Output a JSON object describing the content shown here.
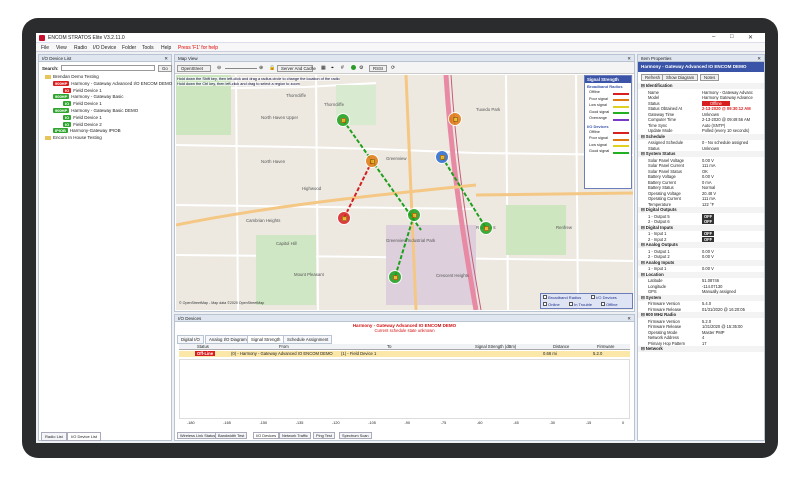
{
  "window": {
    "title": "ENCOM STRATOS Elite V3.2.11.0"
  },
  "menu": [
    "File",
    "View",
    "Radio",
    "I/O Device",
    "Folder",
    "Tools",
    "Help"
  ],
  "menu_hint": "Press 'F1' for help",
  "io_list": {
    "title": "I/O Device List",
    "search_label": "Search:",
    "search_value": "",
    "search_btn": "Go",
    "rows": [
      {
        "kind": "folder",
        "label": "Brendan Demo Testing"
      },
      {
        "kind": "radio",
        "badge": "900HP",
        "badge_color": "red",
        "label": "Harmony - Gateway Advanced I/O ENCOM DEMO"
      },
      {
        "kind": "io",
        "badge": "IO",
        "badge_color": "red",
        "label": "Field Device 1"
      },
      {
        "kind": "radio",
        "badge": "900HP",
        "badge_color": "green",
        "label": "Harmony - Gateway Basic"
      },
      {
        "kind": "io",
        "badge": "IO",
        "badge_color": "green",
        "label": "Field Device 1"
      },
      {
        "kind": "radio",
        "badge": "900HP",
        "badge_color": "green",
        "label": "Harmony - Gateway Basic DEMO"
      },
      {
        "kind": "io",
        "badge": "IO",
        "badge_color": "green",
        "label": "Field Device 1"
      },
      {
        "kind": "io",
        "badge": "IO",
        "badge_color": "green",
        "label": "Field Device 2"
      },
      {
        "kind": "radio",
        "badge": "IPIOB",
        "badge_color": "green",
        "label": "Harmony-Gateway IPIOB"
      },
      {
        "kind": "folder",
        "label": "Encom In House Testing"
      }
    ],
    "bottom_tabs": [
      "Radio List",
      "I/O Device List"
    ]
  },
  "map": {
    "title": "Map View",
    "provider": "OpenStreet",
    "layer": "Server And Cache",
    "rssi": "RSSI",
    "hint1": "Hold down the Shift key, then left-click and drag a radius circle to change the location of the radio",
    "hint2": "Hold down the Ctrl key, then left-click and drag to select a region to zoom",
    "place_labels": [
      "Thorncliffe",
      "North Haven Upper",
      "North Haven",
      "Highwood",
      "Greenview",
      "Cambrian Heights",
      "Greenview Industrial Park",
      "Thorncliffe",
      "Rosemont",
      "Capitol Hill",
      "Mount Pleasant",
      "Tuxedo Park",
      "Renfrew",
      "Crescent Heights"
    ],
    "attribution": "© OpenStreetMap - Map data ©2020 OpenStreetMap",
    "legend": {
      "title": "Signal Strength",
      "broadband_title": "Broadband Radios",
      "broadband": [
        [
          "Offline",
          "#d82020"
        ],
        [
          "Poor signal",
          "#e07a10"
        ],
        [
          "Low signal",
          "#e0d020"
        ],
        [
          "Good signal",
          "#22b022"
        ],
        [
          "Overrange",
          "#7a3ac8"
        ]
      ],
      "io_title": "I/O Devices",
      "io": [
        [
          "Offline",
          "#d82020"
        ],
        [
          "Poor signal",
          "#e07a10"
        ],
        [
          "Low signal",
          "#e0d020"
        ],
        [
          "Good signal",
          "#22b022"
        ]
      ]
    },
    "filters": [
      "Broadband Radios",
      "I/O Devices",
      "Online",
      "In Trouble",
      "Offline"
    ]
  },
  "io_devices": {
    "title": "I/O Devices",
    "heading": "Harmony - Gateway Advanced IO ENCOM DEMO",
    "subheading": "Current schedule state unknown",
    "tabs": [
      "Digital I/O",
      "Analog I/O Diagram",
      "Signal Strength",
      "Schedule Assignment"
    ],
    "columns": [
      "Status",
      "From",
      "To",
      "Signal Strength (dBm)",
      "Distance",
      "Firmware"
    ],
    "row": {
      "status": "Off-Line",
      "from": "(0) - Harmony - Gateway Advanced IO ENCOM DEMO",
      "to": "(1) - Field Device 1",
      "signal": "",
      "distance": "0.66 mi",
      "firmware": "5.2.0"
    },
    "scale": [
      "-180",
      "-165",
      "-150",
      "-135",
      "-120",
      "-105",
      "-90",
      "-75",
      "-60",
      "-45",
      "-30",
      "-15",
      "0"
    ],
    "bottom_tabs": [
      "Wireless Link Status",
      "Bandwidth Test",
      "I/O Devices",
      "Network Traffic",
      "Ping Test",
      "Spectrum Scan"
    ]
  },
  "props": {
    "title": "Item Properties",
    "header": "Harmony - Gateway Advanced IO ENCOM DEMO",
    "buttons": [
      "Refresh",
      "Show Diagram",
      "Notes"
    ],
    "sections": [
      {
        "name": "Identification",
        "rows": [
          [
            "Name",
            "Harmony - Gateway Advanc"
          ],
          [
            "Model",
            "Harmony Gateway Advance"
          ],
          [
            "Status",
            "Offline"
          ],
          [
            "Status Obtained At",
            "2-13-2020 @ 09:30:12 AM"
          ],
          [
            "Gateway Time",
            "Unknown"
          ],
          [
            "Computer Time",
            "2-13-2020 @ 09:49:56 AM"
          ],
          [
            "Time Sync",
            "Auto (SNTP)"
          ],
          [
            "Update Mode",
            "Polled (every 10 seconds)"
          ]
        ]
      },
      {
        "name": "Schedule",
        "rows": [
          [
            "Assigned Schedule",
            "0 - No schedule assigned"
          ],
          [
            "Status",
            "Unknown"
          ]
        ]
      },
      {
        "name": "System Status",
        "rows": [
          [
            "Solar Panel Voltage",
            "0.00 V"
          ],
          [
            "Solar Panel Current",
            "111 mA"
          ],
          [
            "Solar Panel Status",
            "OK"
          ],
          [
            "Battery Voltage",
            "0.00 V"
          ],
          [
            "Battery Current",
            "0 mA"
          ],
          [
            "Battery Status",
            "Normal"
          ],
          [
            "Operating Voltage",
            "20.48 V"
          ],
          [
            "Operating Current",
            "111 mA"
          ],
          [
            "Temperature",
            "122 °F"
          ]
        ]
      },
      {
        "name": "Digital Outputs",
        "rows": [
          [
            "1 - Output 5",
            "OFF"
          ],
          [
            "2 - Output 6",
            "OFF"
          ]
        ]
      },
      {
        "name": "Digital Inputs",
        "rows": [
          [
            "1 - Input 1",
            "OFF"
          ],
          [
            "2 - Input 2",
            "OFF"
          ]
        ]
      },
      {
        "name": "Analog Outputs",
        "rows": [
          [
            "1 - Output 1",
            "0.00 V"
          ],
          [
            "2 - Output 2",
            "0.00 V"
          ]
        ]
      },
      {
        "name": "Analog Inputs",
        "rows": [
          [
            "1 - Input 1",
            "0.00 V"
          ]
        ]
      },
      {
        "name": "Location",
        "rows": [
          [
            "Latitude",
            "51.08746"
          ],
          [
            "Longitude",
            "-114.07130"
          ],
          [
            "GPS",
            "Manually assigned"
          ]
        ]
      },
      {
        "name": "System",
        "rows": [
          [
            "Firmware Version",
            "5.4.0"
          ],
          [
            "Firmware Release",
            "01/31/2020 @ 16:20:05"
          ]
        ]
      },
      {
        "name": "900 MHz Radio",
        "rows": [
          [
            "Firmware Version",
            "5.2.0"
          ],
          [
            "Firmware Release",
            "1/31/2020 @ 15:35:00"
          ],
          [
            "Operating Mode",
            "Master PMP"
          ],
          [
            "Network Address",
            "4"
          ],
          [
            "Primary Hop Pattern",
            "17"
          ]
        ]
      },
      {
        "name": "Network",
        "rows": []
      }
    ]
  }
}
